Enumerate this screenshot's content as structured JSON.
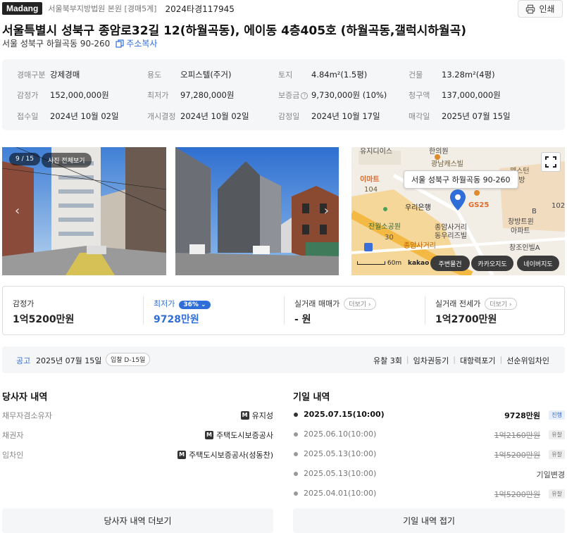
{
  "header": {
    "logo": "Madang",
    "court": "서울북부지방법원 본원 [경매5계]",
    "case_no": "2024타경117945",
    "print_label": "인쇄"
  },
  "title": "서울특별시 성북구 종암로32길 12(하월곡동), 에이동 4층405호 (하월곡동,갤럭시하월곡)",
  "sub_address": "서울 성북구 하월곡동 90-260",
  "copy_label": "주소복사",
  "info": [
    [
      {
        "k": "경매구분",
        "v": "강제경매"
      },
      {
        "k": "용도",
        "v": "오피스텔(주거)"
      },
      {
        "k": "토지",
        "v": "4.84m²(1.5평)"
      },
      {
        "k": "건물",
        "v": "13.28m²(4평)"
      }
    ],
    [
      {
        "k": "감정가",
        "v": "152,000,000원"
      },
      {
        "k": "최저가",
        "v": "97,280,000원"
      },
      {
        "k": "보증금",
        "v": "9,730,000원 (10%)"
      },
      {
        "k": "청구액",
        "v": "137,000,000원"
      }
    ],
    [
      {
        "k": "접수일",
        "v": "2024년 10월 02일"
      },
      {
        "k": "개시결정",
        "v": "2024년 10월 02일"
      },
      {
        "k": "감정일",
        "v": "2024년 10월 17일"
      },
      {
        "k": "매각일",
        "v": "2025년 07월 15일"
      }
    ]
  ],
  "photos": {
    "counter": "9 / 15",
    "view_all": "사진 전체보기"
  },
  "map": {
    "tooltip": "서울 성북구 하월곡동 90-260",
    "scale_label": "60m",
    "provider": "kakao",
    "buttons": [
      "주변물건",
      "카카오지도",
      "네이버지도"
    ],
    "labels": [
      "유지디이스",
      "한의원",
      "광남캐스빌",
      "이마트",
      "웨스턴",
      "104",
      "우리은행",
      "GS25",
      "창방트윈",
      "아파트",
      "잔월소공원",
      "종암사거리",
      "동우리즈빌",
      "30",
      "종암사거리",
      "창조인빌A",
      "102",
      "B",
      "재방"
    ]
  },
  "prices": {
    "appraisal": {
      "label": "감정가",
      "value": "1억5200만원"
    },
    "minimum": {
      "label": "최저가",
      "pct": "36%",
      "value": "9728만원"
    },
    "trade": {
      "label": "실거래 매매가",
      "more": "더보기",
      "value": "- 원"
    },
    "lease": {
      "label": "실거래 전세가",
      "more": "더보기",
      "value": "1억2700만원"
    }
  },
  "notice": {
    "label": "공고",
    "date": "2025년 07월 15일",
    "dday": "입찰 D-15일",
    "tags": [
      "유찰 3회",
      "임차권등기",
      "대항력포기",
      "선순위임차인"
    ]
  },
  "parties": {
    "title": "당사자 내역",
    "rows": [
      {
        "k": "채무자겸소유자",
        "mark": "M",
        "v": "유지성"
      },
      {
        "k": "채권자",
        "mark": "M",
        "v": "주택도시보증공사"
      },
      {
        "k": "임차인",
        "mark": "M",
        "v": "주택도시보증공사(성동찬)"
      }
    ],
    "more_button": "당사자 내역 더보기"
  },
  "history": {
    "title": "기일 내역",
    "rows": [
      {
        "date": "2025.07.15(10:00)",
        "price": "9728만원",
        "status": "진행",
        "active": true
      },
      {
        "date": "2025.06.10(10:00)",
        "price": "1억2160만원",
        "status": "유찰"
      },
      {
        "date": "2025.05.13(10:00)",
        "price": "1억5200만원",
        "status": "유찰"
      },
      {
        "date": "2025.05.13(10:00)",
        "price": "기일변경",
        "status": ""
      },
      {
        "date": "2025.04.01(10:00)",
        "price": "1억5200만원",
        "status": "유찰"
      }
    ],
    "collapse_button": "기일 내역 접기"
  }
}
